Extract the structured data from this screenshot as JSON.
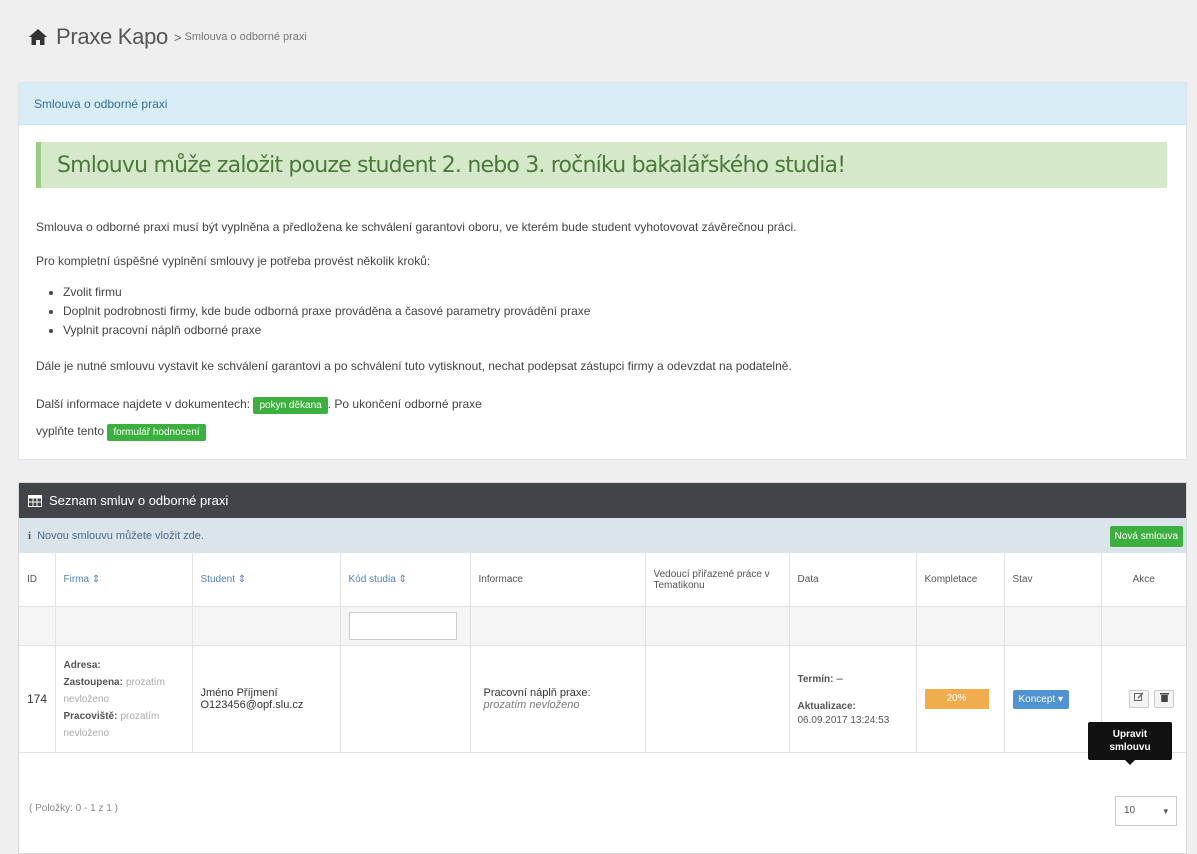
{
  "breadcrumb": {
    "app_title": "Praxe Kapo",
    "separator": ">",
    "current": "Smlouva o odborné praxi"
  },
  "intro_panel": {
    "heading": "Smlouva o odborné praxi",
    "alert": "Smlouvu může založit pouze student 2. nebo 3. ročníku bakalářského studia!",
    "paragraph1": "Smlouva o odborné praxi musí být vyplněna a předložena ke schválení garantovi oboru, ve kterém bude student vyhotovovat závěrečnou práci.",
    "paragraph2": "Pro kompletní úspěšné vyplnění smlouvy je potřeba provést několik kroků:",
    "steps": [
      "Zvolit firmu",
      "Doplnit podrobnosti firmy, kde bude odborná praxe prováděna a časové parametry provádění praxe",
      "Vyplnit pracovní náplň odborné praxe"
    ],
    "paragraph3": "Dále je nutné smlouvu vystavit ke schválení garantovi a po schválení tuto vytisknout, nechat podepsat zástupci firmy a odevzdat na podatelně.",
    "more_info_prefix": "Další informace najdete v dokumentech:",
    "link_guide": "pokyn děkana",
    "more_info_middle": ". Po ukončení odborné praxe",
    "fill_prefix": "vyplňte tento",
    "link_form": "formulář hodnocení"
  },
  "list_panel": {
    "title": "Seznam smluv o odborné praxi",
    "info_text": "Novou smlouvu můžete vložit zde.",
    "new_button": "Nová smlouva",
    "columns": {
      "id": "ID",
      "firm": "Firma ⇕",
      "student": "Student ⇕",
      "study_code": "Kód studia ⇕",
      "info": "Informace",
      "supervisor": "Vedoucí přiřazené práce v Tematikonu",
      "dates": "Data",
      "completion": "Kompletace",
      "state": "Stav",
      "actions": "Akce"
    },
    "row": {
      "id": "174",
      "address_label": "Adresa:",
      "represented_label": "Zastoupena:",
      "represented_value": "prozatím nevloženo",
      "workplace_label": "Pracoviště:",
      "workplace_value": "prozatím nevloženo",
      "student_name": "Jméno Příjmení",
      "student_email": "O123456@opf.slu.cz",
      "info_label": "Pracovní náplň praxe:",
      "info_value": "prozatím nevloženo",
      "term_label": "Termín:",
      "term_value": "–",
      "updated_label": "Aktualizace:",
      "updated_value": "06.09.2017 13:24:53",
      "completion": "20%",
      "completion_fraction": 0.2,
      "state": "Koncept ▾"
    },
    "tooltip": "Upravit smlouvu",
    "paging": "( Položky: 0 - 1 z 1 )",
    "page_size": "10",
    "page_size_arrow": "▾"
  },
  "colors": {
    "alert_bg": "#d5e8c9",
    "success": "#3bb03e",
    "warning": "#f0ad4e",
    "primary": "#4f93d2",
    "dark_header": "#414549"
  }
}
